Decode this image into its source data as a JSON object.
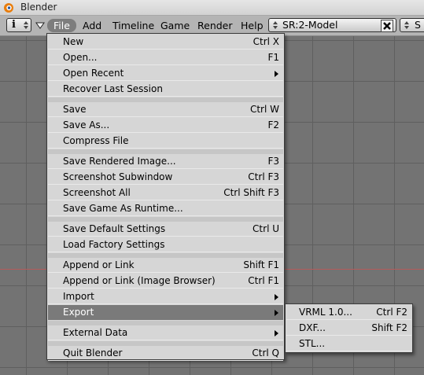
{
  "window": {
    "title": "Blender"
  },
  "header": {
    "menus": [
      {
        "id": "file",
        "label": "File"
      },
      {
        "id": "add",
        "label": "Add"
      },
      {
        "id": "timeline",
        "label": "Timeline"
      },
      {
        "id": "game",
        "label": "Game"
      },
      {
        "id": "render",
        "label": "Render"
      },
      {
        "id": "help",
        "label": "Help"
      }
    ],
    "editor_type_glyph": "i",
    "screen_name": "SR:2-Model",
    "screen_close_glyph": "✖",
    "scene_name": "S"
  },
  "file_menu": {
    "items": [
      {
        "label": "New",
        "shortcut": "Ctrl X"
      },
      {
        "label": "Open...",
        "shortcut": "F1"
      },
      {
        "label": "Open Recent",
        "shortcut": "",
        "submenu": true
      },
      {
        "label": "Recover Last Session",
        "shortcut": ""
      },
      {
        "label": "Save",
        "shortcut": "Ctrl W"
      },
      {
        "label": "Save As...",
        "shortcut": "F2"
      },
      {
        "label": "Compress File",
        "shortcut": ""
      },
      {
        "label": "Save Rendered Image...",
        "shortcut": "F3"
      },
      {
        "label": "Screenshot Subwindow",
        "shortcut": "Ctrl F3"
      },
      {
        "label": "Screenshot All",
        "shortcut": "Ctrl Shift F3"
      },
      {
        "label": "Save Game As Runtime...",
        "shortcut": ""
      },
      {
        "label": "Save Default Settings",
        "shortcut": "Ctrl U"
      },
      {
        "label": "Load Factory Settings",
        "shortcut": ""
      },
      {
        "label": "Append or Link",
        "shortcut": "Shift F1"
      },
      {
        "label": "Append or Link (Image Browser)",
        "shortcut": "Ctrl F1"
      },
      {
        "label": "Import",
        "shortcut": "",
        "submenu": true
      },
      {
        "label": "Export",
        "shortcut": "",
        "submenu": true,
        "active": true
      },
      {
        "label": "External Data",
        "shortcut": "",
        "submenu": true
      },
      {
        "label": "Quit Blender",
        "shortcut": "Ctrl Q"
      }
    ]
  },
  "export_submenu": {
    "items": [
      {
        "label": "VRML 1.0...",
        "shortcut": "Ctrl F2"
      },
      {
        "label": "DXF...",
        "shortcut": "Shift F2"
      },
      {
        "label": "STL...",
        "shortcut": ""
      }
    ]
  },
  "colors": {
    "menu_bg": "#d6d6d6",
    "menu_highlight": "#7a7a7a",
    "viewport_bg": "#737373",
    "header_bg": "#b4b4b4",
    "x_axis": "#b55a5a"
  }
}
